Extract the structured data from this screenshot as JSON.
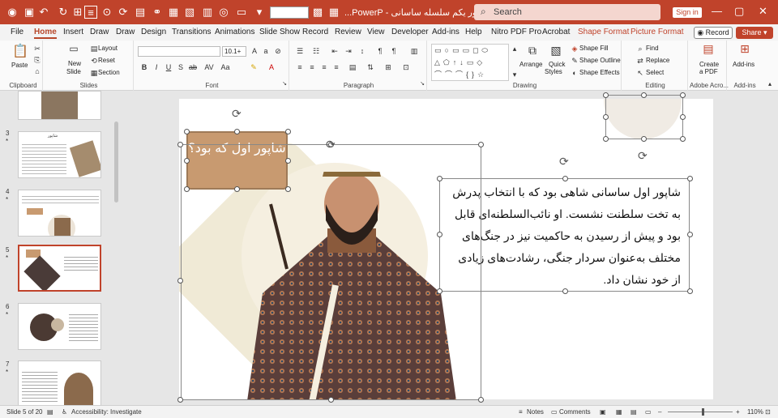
{
  "titlebar": {
    "doc_title": "شاپور یکم سلسله ساسانی - PowerP...",
    "search_placeholder": "Search",
    "sign_in": "Sign in",
    "accent": "#c0432b"
  },
  "tabs": [
    "File",
    "Home",
    "Insert",
    "Draw",
    "Draw",
    "Design",
    "Transitions",
    "Animations",
    "Slide Show",
    "Record",
    "Review",
    "View",
    "Developer",
    "Add-ins",
    "Help",
    "Nitro PDF Pro",
    "Acrobat",
    "Shape Format",
    "Picture Format"
  ],
  "active_tab": "Home",
  "record_label": "Record",
  "share_label": "Share",
  "ribbon": {
    "clipboard": {
      "label": "Clipboard",
      "paste": "Paste"
    },
    "slides": {
      "label": "Slides",
      "new_slide": "New",
      "new_slide2": "Slide",
      "layout": "Layout",
      "reset": "Reset",
      "section": "Section"
    },
    "font": {
      "label": "Font",
      "size": "10.1+"
    },
    "paragraph": {
      "label": "Paragraph"
    },
    "drawing": {
      "label": "Drawing",
      "arrange": "Arrange",
      "quick_styles": "Quick",
      "quick_styles2": "Styles",
      "shape_fill": "Shape Fill",
      "shape_outline": "Shape Outline",
      "shape_effects": "Shape Effects"
    },
    "editing": {
      "label": "Editing",
      "find": "Find",
      "replace": "Replace",
      "select": "Select"
    },
    "adobe": {
      "label": "Adobe Acro...",
      "create_pdf": "Create",
      "create_pdf2": "a PDF"
    },
    "addins": {
      "label": "Add-ins",
      "addins_btn": "Add-ins"
    }
  },
  "thumbnails": [
    {
      "num": "3",
      "star": "*",
      "title": "شاپور"
    },
    {
      "num": "4",
      "star": "*"
    },
    {
      "num": "5",
      "star": "*"
    },
    {
      "num": "6",
      "star": "*"
    },
    {
      "num": "7",
      "star": "*"
    }
  ],
  "slide": {
    "title": "شاپور اول که بود؟",
    "body": "شاپور اول ساسانی شاهی بود که با انتخاب پدرش به تخت سلطنت نشست. او نائب‌السلطنه‌ای قابل بود و پیش از رسیدن به حاکمیت نیز در جنگ‌های مختلف به‌عنوان سردار جنگی، رشادت‌های زیادی از خود نشان داد."
  },
  "status": {
    "slide_info": "Slide 5 of 20",
    "accessibility": "Accessibility: Investigate",
    "notes": "Notes",
    "comments": "Comments",
    "zoom": "110%"
  }
}
